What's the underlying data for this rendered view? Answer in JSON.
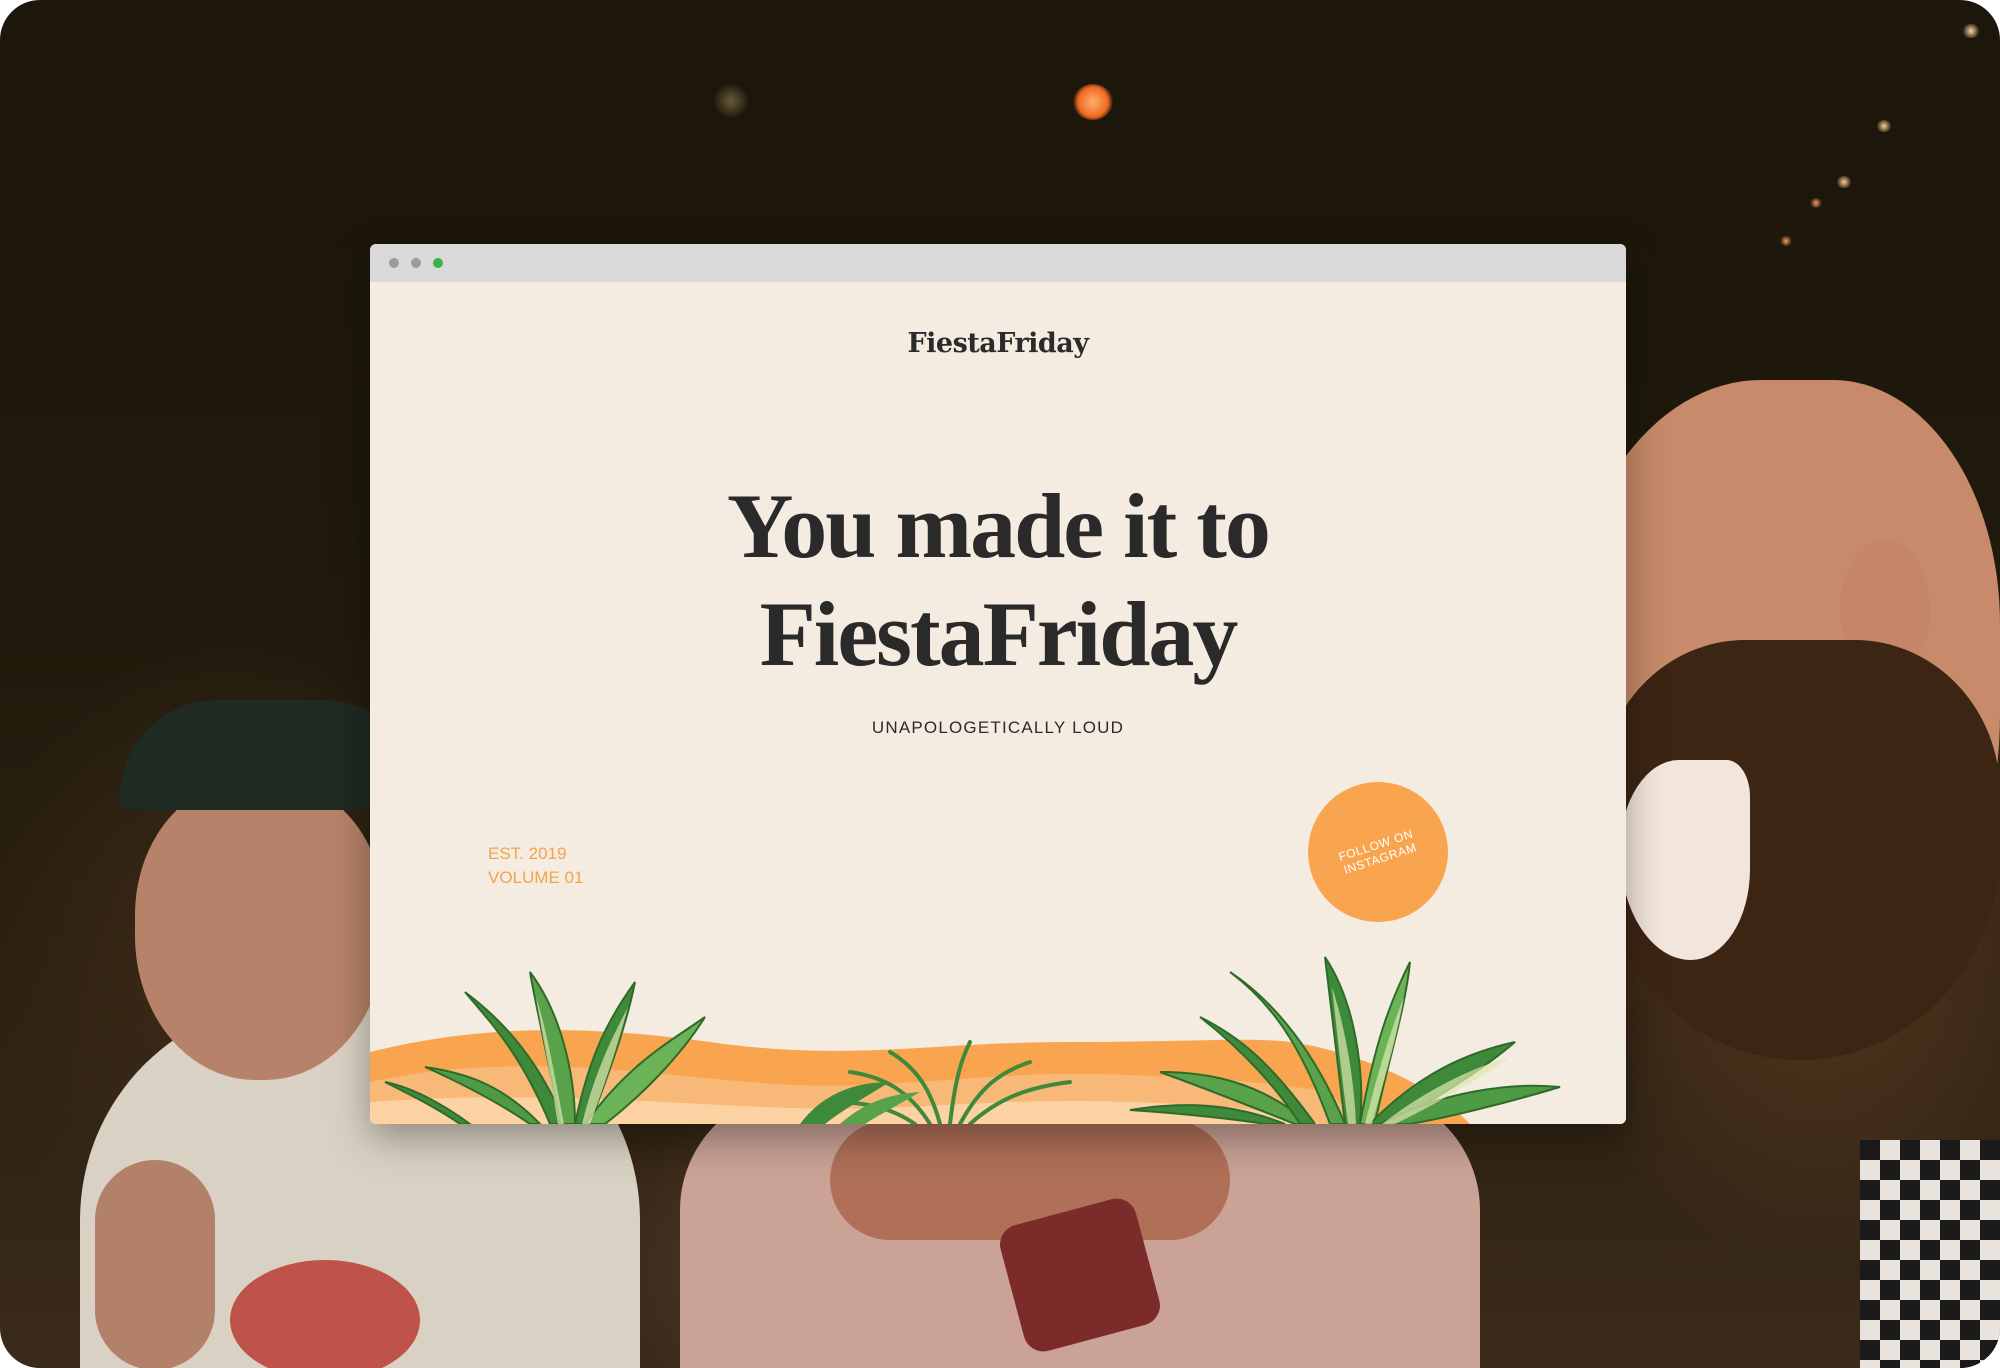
{
  "browser": {
    "window_dots": [
      "close",
      "minimize",
      "maximize"
    ]
  },
  "site": {
    "logo": "FiestaFriday",
    "headline_line1": "You made it to",
    "headline_line2": "FiestaFriday",
    "tagline": "UNAPOLOGETICALLY LOUD",
    "est": "EST. 2019",
    "volume": "VOLUME 01",
    "follow_line1": "FOLLOW ON",
    "follow_line2": "INSTAGRAM"
  },
  "colors": {
    "page_background": "#f5ece1",
    "accent_orange": "#f9a54f",
    "text_dark": "#2b2b2b",
    "titlebar": "#d9d9d9",
    "leaf_green": "#3f8a3a"
  },
  "icons": {
    "decoration": "tropical-leaves-illustration"
  }
}
